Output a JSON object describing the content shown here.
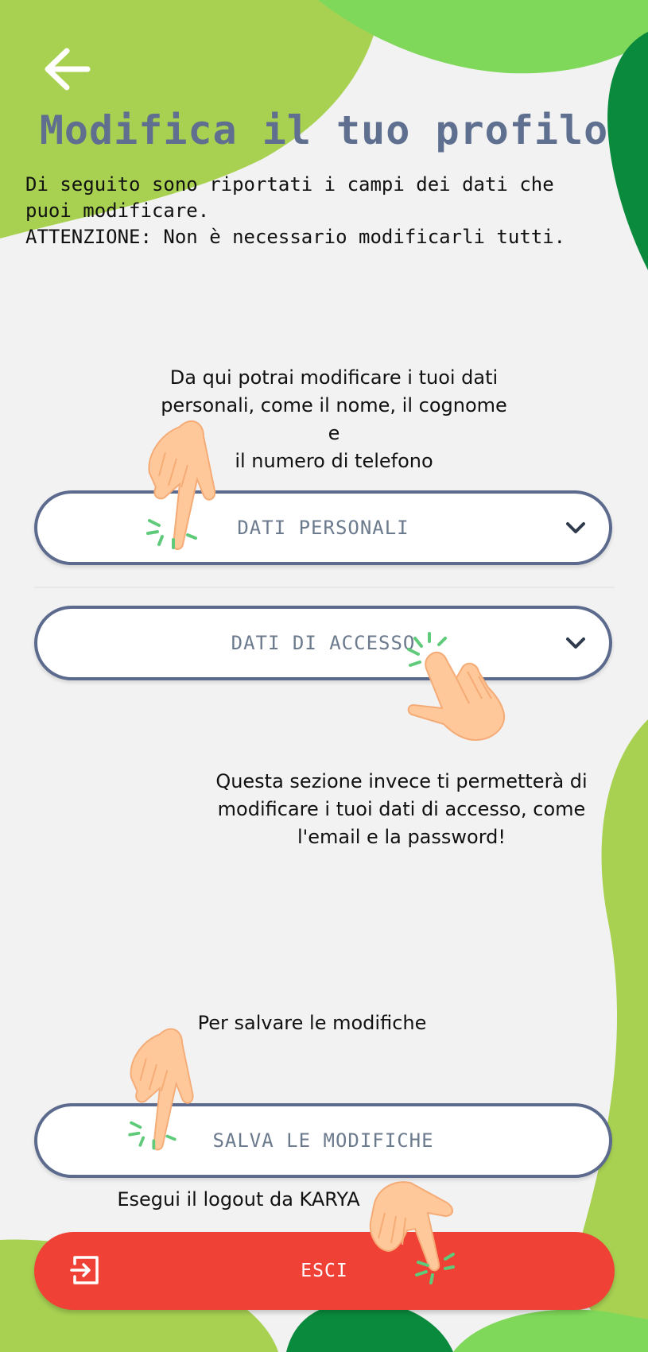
{
  "colors": {
    "green_light": "#a8d152",
    "green_bright": "#7fd85a",
    "green_dark": "#0a8a3c",
    "button_border": "#5c6a8e",
    "title": "#5e6f8f",
    "exit_red": "#ef4136",
    "hand": "#ffc89a",
    "tap_marks": "#5fcb7a"
  },
  "header": {
    "back_icon": "arrow-left-icon",
    "title": "Modifica il tuo profilo"
  },
  "intro": {
    "line1": "Di seguito sono riportati i campi dei dati che",
    "line2": "puoi modificare.",
    "line3": "ATTENZIONE: Non è necessario modificarli tutti."
  },
  "hints": {
    "personal_line1": "Da qui potrai modificare i tuoi dati",
    "personal_line2": "personali, come il nome, il cognome e",
    "personal_line3": "il numero di telefono",
    "access_line1": "Questa sezione invece ti permetterà di",
    "access_line2": "modificare i tuoi dati di accesso, come",
    "access_line3": "l'email e la password!",
    "save": "Per salvare le modifiche",
    "logout": "Esegui il logout da KARYA"
  },
  "sections": {
    "personal_label": "DATI PERSONALI",
    "access_label": "DATI DI ACCESSO",
    "expand_icon": "chevron-down-icon"
  },
  "actions": {
    "save_label": "SALVA LE MODIFICHE",
    "exit_label": "ESCI",
    "exit_icon": "logout-icon"
  }
}
